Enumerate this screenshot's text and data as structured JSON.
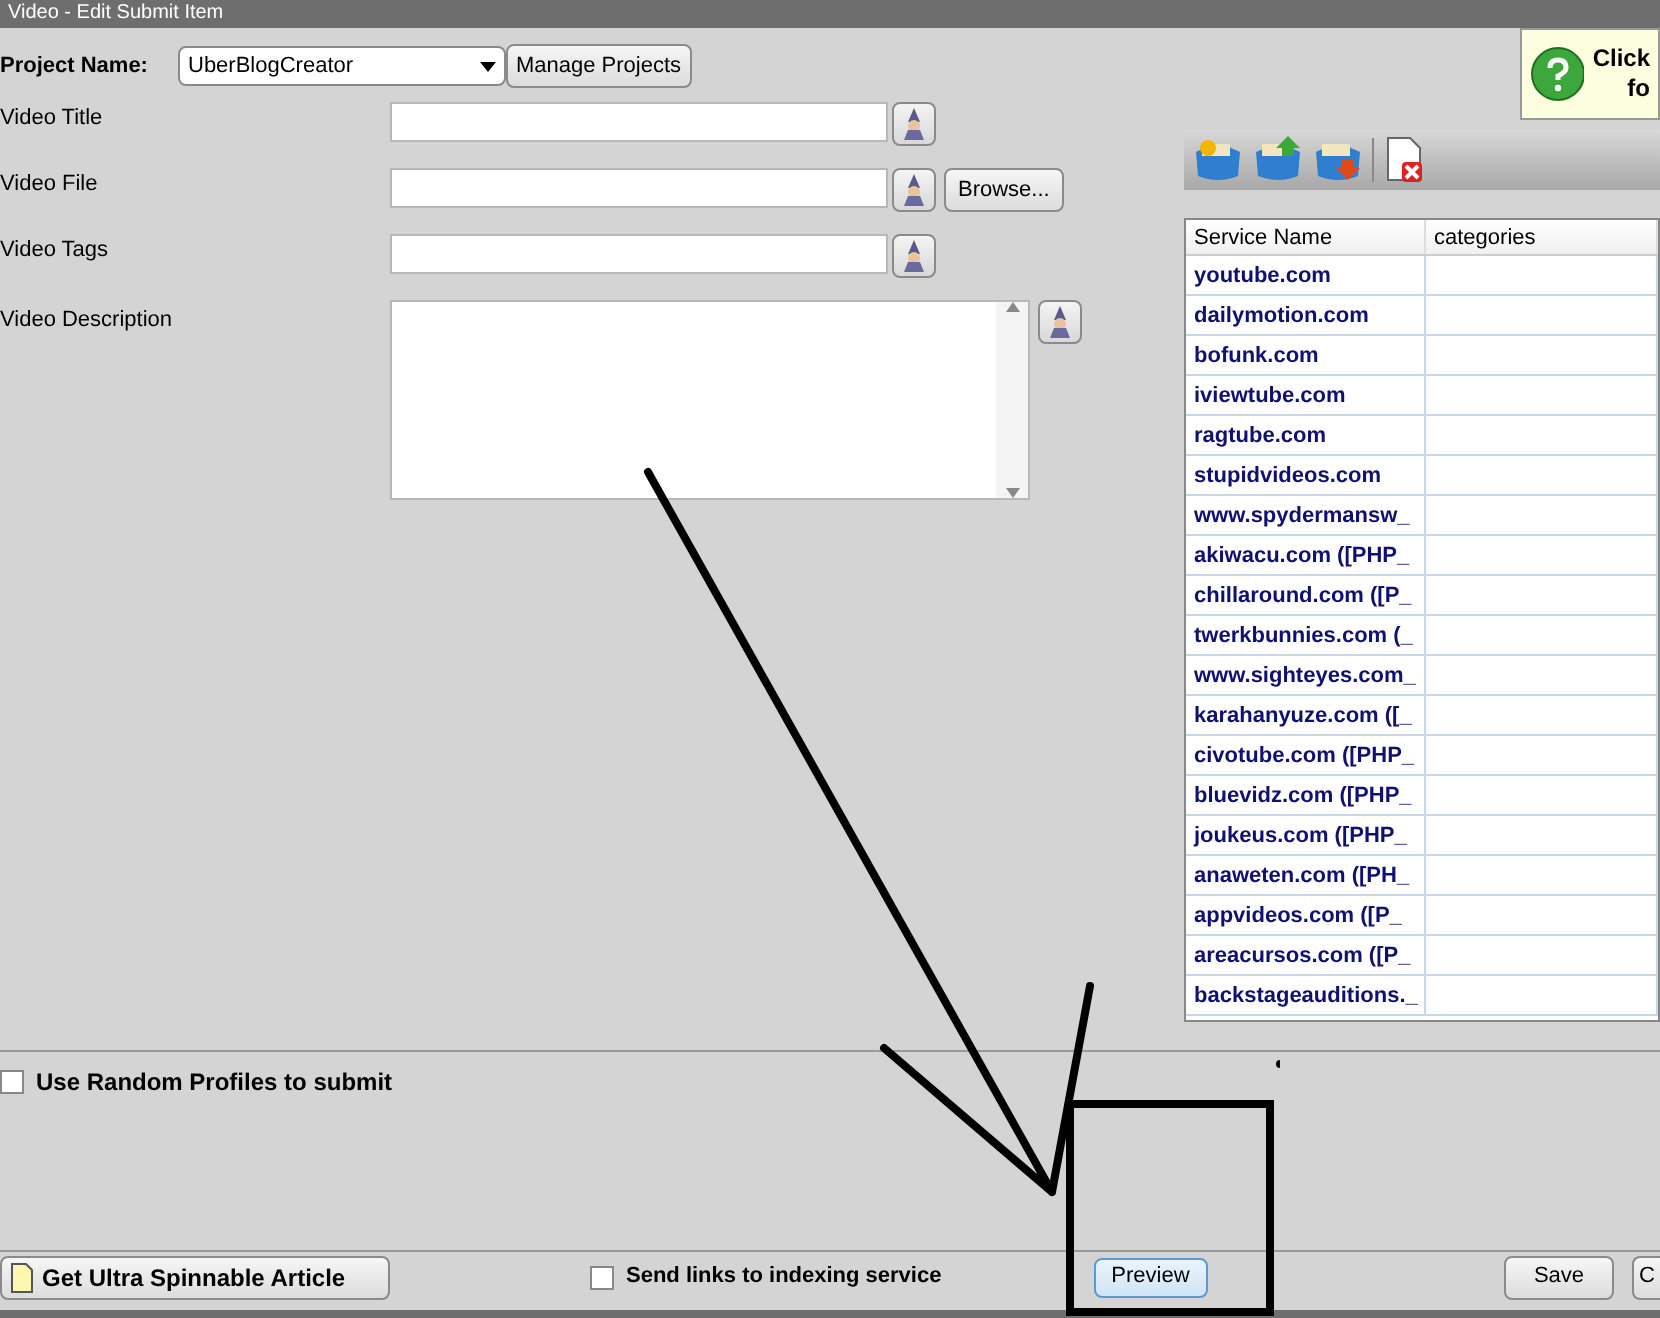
{
  "window": {
    "title": "Video - Edit Submit Item"
  },
  "project": {
    "label": "Project Name:",
    "value": "UberBlogCreator",
    "manage_button": "Manage Projects"
  },
  "help_button": {
    "line_1": "Click",
    "line_2": "fo"
  },
  "fields": [
    {
      "kind": "line",
      "label": "Video Title"
    },
    {
      "kind": "file",
      "label": "Video File",
      "browse": "Browse..."
    },
    {
      "kind": "line",
      "label": "Video Tags"
    },
    {
      "kind": "area",
      "label": "Video Description"
    }
  ],
  "table": {
    "columns": [
      "Service Name",
      "categories"
    ],
    "rows": [
      {
        "cells": [
          "youtube.com"
        ]
      },
      {
        "cells": [
          "dailymotion.com"
        ]
      },
      {
        "cells": [
          "bofunk.com"
        ]
      },
      {
        "cells": [
          "iviewtube.com"
        ]
      },
      {
        "cells": [
          "ragtube.com"
        ]
      },
      {
        "cells": [
          "stupidvideos.com"
        ]
      },
      {
        "cells": [
          "www.spydermansw_"
        ]
      },
      {
        "cells": [
          "akiwacu.com ([PHP_"
        ]
      },
      {
        "cells": [
          "chillaround.com ([P_"
        ]
      },
      {
        "cells": [
          "twerkbunnies.com (_"
        ]
      },
      {
        "cells": [
          "www.sighteyes.com_"
        ]
      },
      {
        "cells": [
          "karahanyuze.com ([_"
        ]
      },
      {
        "cells": [
          "civotube.com ([PHP_"
        ]
      },
      {
        "cells": [
          "bluevidz.com ([PHP_"
        ]
      },
      {
        "cells": [
          "joukeus.com ([PHP_"
        ]
      },
      {
        "cells": [
          "anaweten.com ([PH_"
        ]
      },
      {
        "cells": [
          "appvideos.com ([P_"
        ]
      },
      {
        "cells": [
          "areacursos.com ([P_"
        ]
      },
      {
        "cells": [
          "backstageauditions._"
        ]
      }
    ]
  },
  "random_profiles": {
    "label": "Use Random Profiles to submit",
    "checked": false
  },
  "footer": {
    "article_button": "Get Ultra Spinnable Article",
    "indexing": {
      "label": "Send links to indexing service",
      "checked": false
    },
    "preview": "Preview",
    "save": "Save",
    "cut_button": "C"
  }
}
